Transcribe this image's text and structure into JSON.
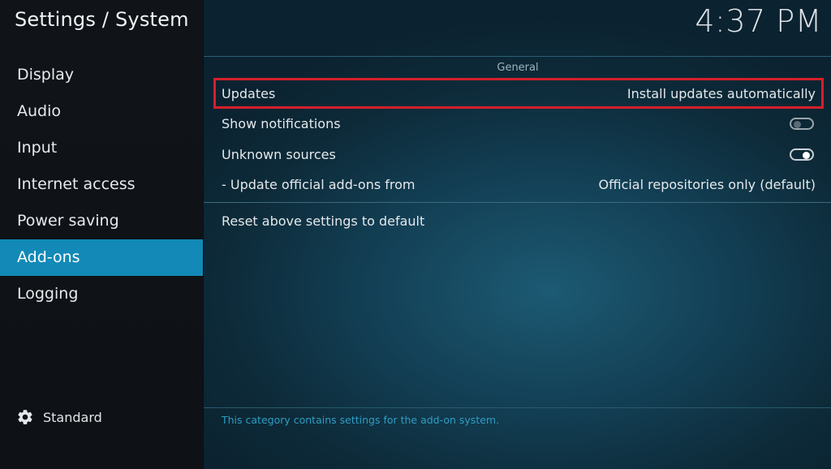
{
  "header": {
    "title": "Settings / System",
    "clock": "4:37 PM"
  },
  "sidebar": {
    "items": [
      {
        "label": "Display"
      },
      {
        "label": "Audio"
      },
      {
        "label": "Input"
      },
      {
        "label": "Internet access"
      },
      {
        "label": "Power saving"
      },
      {
        "label": "Add-ons",
        "selected": true
      },
      {
        "label": "Logging"
      }
    ],
    "settings_level": {
      "label": "Standard",
      "icon": "gear-icon"
    }
  },
  "main": {
    "section_title": "General",
    "settings": {
      "updates": {
        "label": "Updates",
        "value": "Install updates automatically"
      },
      "show_notifications": {
        "label": "Show notifications",
        "enabled": false
      },
      "unknown_sources": {
        "label": "Unknown sources",
        "enabled": true
      },
      "update_official": {
        "label": "- Update official add-ons from",
        "value": "Official repositories only (default)"
      },
      "reset": {
        "label": "Reset above settings to default"
      }
    },
    "help_text": "This category contains settings for the add-on system."
  },
  "colors": {
    "accent": "#1289b6",
    "highlight_border": "#d3202b",
    "help_text": "#2f9dc4"
  }
}
